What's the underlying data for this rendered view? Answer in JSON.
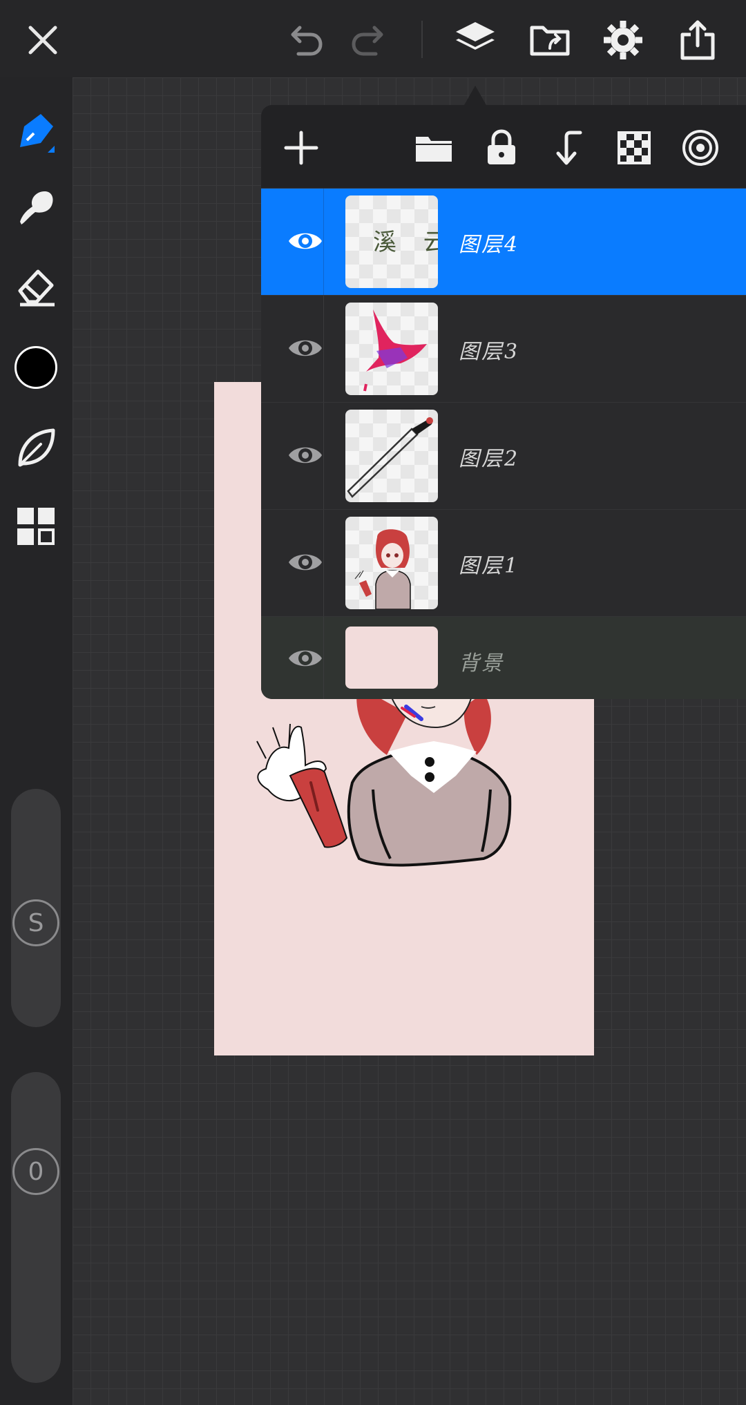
{
  "topbar": {
    "icons": [
      "close-icon",
      "undo-icon",
      "redo-icon",
      "layers-icon",
      "import-icon",
      "settings-icon",
      "share-icon"
    ]
  },
  "sidebar": {
    "tools": [
      "pen-icon",
      "smudge-icon",
      "eraser-icon",
      "color-swatch",
      "leaf-icon",
      "grid-icon"
    ],
    "current_color": "#000000",
    "size_label": "S",
    "opacity_label": "0"
  },
  "layers_panel": {
    "tools": [
      "add-layer-icon",
      "folder-icon",
      "lock-icon",
      "merge-down-icon",
      "transparency-icon",
      "radial-icon"
    ],
    "layers": [
      {
        "name": "图层4",
        "selected": true,
        "visible": true,
        "thumb_text": "溪 云"
      },
      {
        "name": "图层3",
        "selected": false,
        "visible": true
      },
      {
        "name": "图层2",
        "selected": false,
        "visible": true
      },
      {
        "name": "图层1",
        "selected": false,
        "visible": true
      },
      {
        "name": "背景",
        "selected": false,
        "visible": true
      }
    ]
  },
  "colors": {
    "accent": "#0a7cff",
    "canvas_bg": "#f2dcdb",
    "hair_red": "#c9403f"
  }
}
